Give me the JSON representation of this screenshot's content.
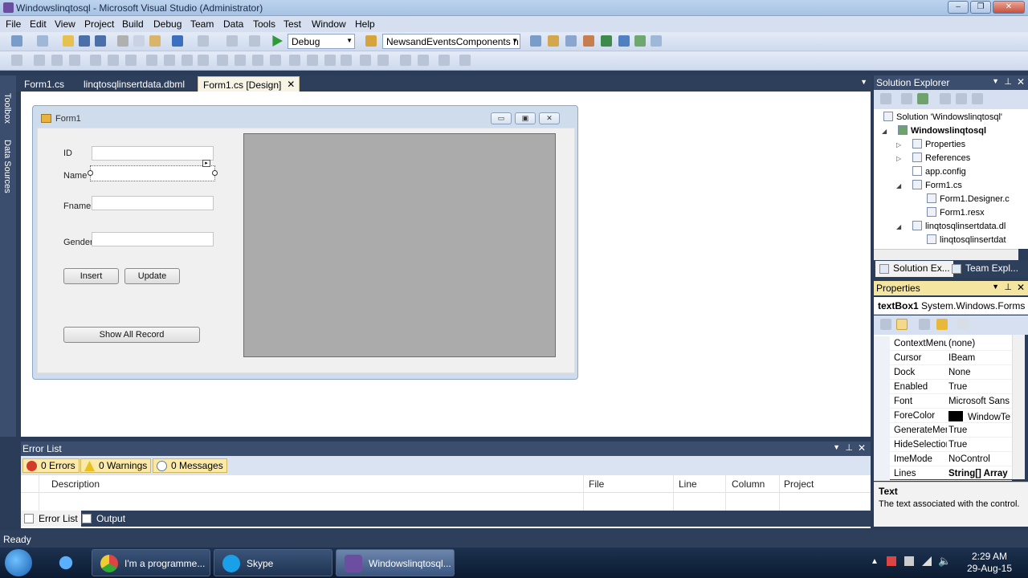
{
  "window": {
    "title": "Windowslinqtosql - Microsoft Visual Studio (Administrator)"
  },
  "menu": [
    "File",
    "Edit",
    "View",
    "Project",
    "Build",
    "Debug",
    "Team",
    "Data",
    "Tools",
    "Test",
    "Window",
    "Help"
  ],
  "toolbar": {
    "config": "Debug",
    "startup_project": "NewsandEventsComponents n"
  },
  "leftstrip": {
    "toolbox": "Toolbox",
    "datasources": "Data Sources"
  },
  "doctabs": [
    "Form1.cs",
    "linqtosqlinsertdata.dbml",
    "Form1.cs [Design]"
  ],
  "form": {
    "caption": "Form1",
    "labels": {
      "id": "ID",
      "name": "Name",
      "fname": "Fname",
      "gender": "Gender"
    },
    "buttons": {
      "insert": "Insert",
      "update": "Update",
      "show_all": "Show All Record"
    }
  },
  "errorlist": {
    "title": "Error List",
    "errors": "0 Errors",
    "warnings": "0 Warnings",
    "messages": "0 Messages",
    "columns": [
      "Description",
      "File",
      "Line",
      "Column",
      "Project"
    ],
    "tabs": [
      "Error List",
      "Output"
    ]
  },
  "solution": {
    "title": "Solution Explorer",
    "tree": [
      "Solution 'Windowslinqtosql'",
      "Windowslinqtosql",
      "Properties",
      "References",
      "app.config",
      "Form1.cs",
      "Form1.Designer.c",
      "Form1.resx",
      "linqtosqlinsertdata.dl",
      "linqtosqlinsertdat"
    ],
    "tabs": [
      "Solution Ex...",
      "Team Expl..."
    ]
  },
  "properties": {
    "title": "Properties",
    "object": "textBox1",
    "object_type": "System.Windows.Forms",
    "rows": [
      {
        "name": "ContextMenu",
        "value": "(none)"
      },
      {
        "name": "Cursor",
        "value": "IBeam"
      },
      {
        "name": "Dock",
        "value": "None"
      },
      {
        "name": "Enabled",
        "value": "True"
      },
      {
        "name": "Font",
        "value": "Microsoft Sans"
      },
      {
        "name": "ForeColor",
        "value": "WindowTe"
      },
      {
        "name": "GenerateMer",
        "value": "True"
      },
      {
        "name": "HideSelection",
        "value": "True"
      },
      {
        "name": "ImeMode",
        "value": "NoControl"
      },
      {
        "name": "Lines",
        "value": "String[] Array"
      }
    ],
    "desc_title": "Text",
    "desc_text": "The text associated with the control."
  },
  "status": "Ready",
  "taskbar": {
    "tasks": [
      "I'm a programme...",
      "Skype",
      "Windowslinqtosql..."
    ],
    "time": "2:29 AM",
    "date": "29-Aug-15"
  }
}
